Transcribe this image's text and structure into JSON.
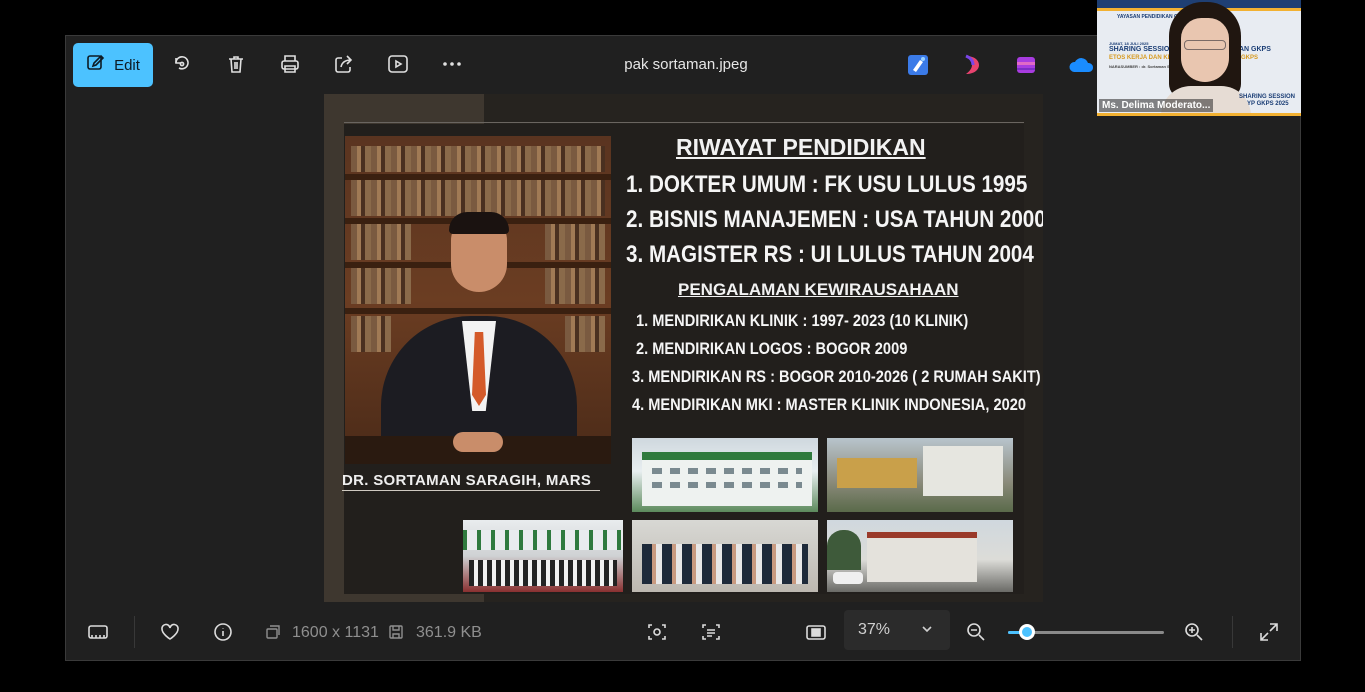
{
  "window": {
    "title": "pak sortaman.jpeg"
  },
  "toolbar": {
    "edit_label": "Edit",
    "icons": [
      "edit-icon",
      "rotate-icon",
      "delete-icon",
      "print-icon",
      "share-icon",
      "slideshow-icon",
      "more-icon"
    ],
    "apps": [
      "designer-icon",
      "clipchamp-icon",
      "copilot-icon",
      "onedrive-icon"
    ]
  },
  "slide": {
    "title": "RIWAYAT PENDIDIKAN",
    "education": [
      "1. DOKTER UMUM : FK USU LULUS 1995",
      "2. BISNIS MANAJEMEN : USA TAHUN 2000",
      "3. MAGISTER RS : UI LULUS TAHUN 2004"
    ],
    "subtitle": "PENGALAMAN KEWIRAUSAHAAN",
    "experience": [
      "1. MENDIRIKAN KLINIK : 1997- 2023 (10 KLINIK)",
      "2. MENDIRIKAN LOGOS : BOGOR 2009",
      "3. MENDIRIKAN RS : BOGOR 2010-2026 ( 2 RUMAH SAKIT)",
      "4. MENDIRIKAN MKI : MASTER KLINIK INDONESIA, 2020"
    ],
    "person_name": "DR. SORTAMAN SARAGIH, MARS"
  },
  "statusbar": {
    "dimensions": "1600 x 1131",
    "filesize": "361.9 KB",
    "zoom": "37%",
    "zoom_level": 0.04
  },
  "camera": {
    "name": "Ms. Delima Moderato...",
    "header": "YAYASAN PENDIDIKAN GKPS",
    "date": "JUMAT, 18 JULI 2025",
    "session": "SHARING SESSION",
    "session_tail": "AN GKPS",
    "topic": "ETOS KERJA DAN KEM",
    "topic_tail": "GKPS",
    "narasumber": "NARASUMBER : dr. Sortaman Saragih",
    "badge1": "SHARING SESSION",
    "badge2": "YP GKPS 2025"
  },
  "colors": {
    "accent": "#4cc2ff",
    "window_bg": "#202020",
    "slide_bg": "#221f1c"
  }
}
